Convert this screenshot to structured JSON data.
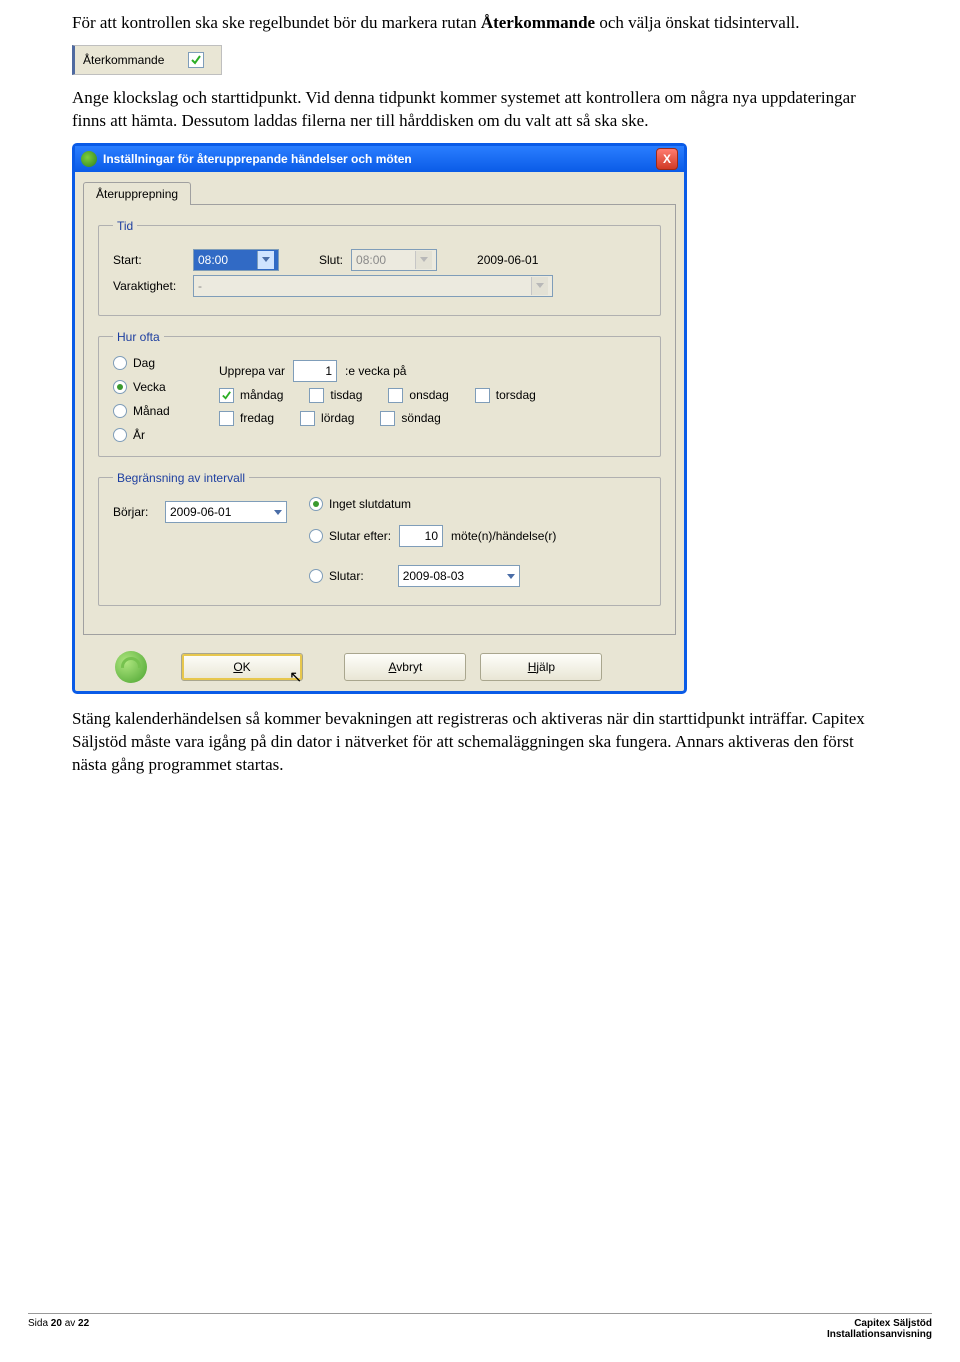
{
  "doc": {
    "para1_a": "För att kontrollen ska ske regelbundet bör du markera rutan ",
    "para1_b": "Återkommande",
    "para1_c": " och välja önskat tidsintervall.",
    "aterkommande_label": "Återkommande",
    "para2": "Ange klockslag och starttidpunkt. Vid denna tidpunkt kommer systemet att kontrollera om några nya uppdateringar finns att hämta. Dessutom laddas filerna ner till hårddisken om du valt att så ska ske.",
    "para3": "Stäng kalenderhändelsen så kommer bevakningen att registreras och aktiveras när din starttidpunkt inträffar. Capitex Säljstöd måste vara igång på din dator i nätverket för att schemaläggningen ska fungera. Annars aktiveras den först nästa gång programmet startas."
  },
  "dialog": {
    "title": "Inställningar för återupprepande händelser och möten",
    "close_x": "X",
    "tab": "Återupprepning",
    "tid": {
      "legend": "Tid",
      "start_label": "Start:",
      "start_value": "08:00",
      "slut_label": "Slut:",
      "slut_value": "08:00",
      "date_value": "2009-06-01",
      "duration_label": "Varaktighet:",
      "duration_value": "-"
    },
    "hurofta": {
      "legend": "Hur ofta",
      "dag": "Dag",
      "vecka": "Vecka",
      "manad": "Månad",
      "ar": "År",
      "upprepa_pre": "Upprepa var",
      "upprepa_val": "1",
      "upprepa_post": ":e vecka på",
      "days": {
        "mandag": "måndag",
        "tisdag": "tisdag",
        "onsdag": "onsdag",
        "torsdag": "torsdag",
        "fredag": "fredag",
        "lordag": "lördag",
        "sondag": "söndag"
      }
    },
    "limit": {
      "legend": "Begränsning av intervall",
      "borjar_label": "Börjar:",
      "borjar_value": "2009-06-01",
      "ingen": "Inget slutdatum",
      "slutar_efter": "Slutar efter:",
      "slutar_efter_val": "10",
      "slutar_efter_post": "möte(n)/händelse(r)",
      "slutar": "Slutar:",
      "slutar_value": "2009-08-03"
    },
    "buttons": {
      "ok_pre": "O",
      "ok_u": "K",
      "avbryt_u": "A",
      "avbryt_post": "vbryt",
      "hjalp_u": "H",
      "hjalp_post": "jälp"
    }
  },
  "footer": {
    "left_pre": "Sida ",
    "page": "20",
    "left_mid": " av ",
    "total": "22",
    "brand": "Capitex Säljstöd",
    "sub": "Installationsanvisning"
  }
}
